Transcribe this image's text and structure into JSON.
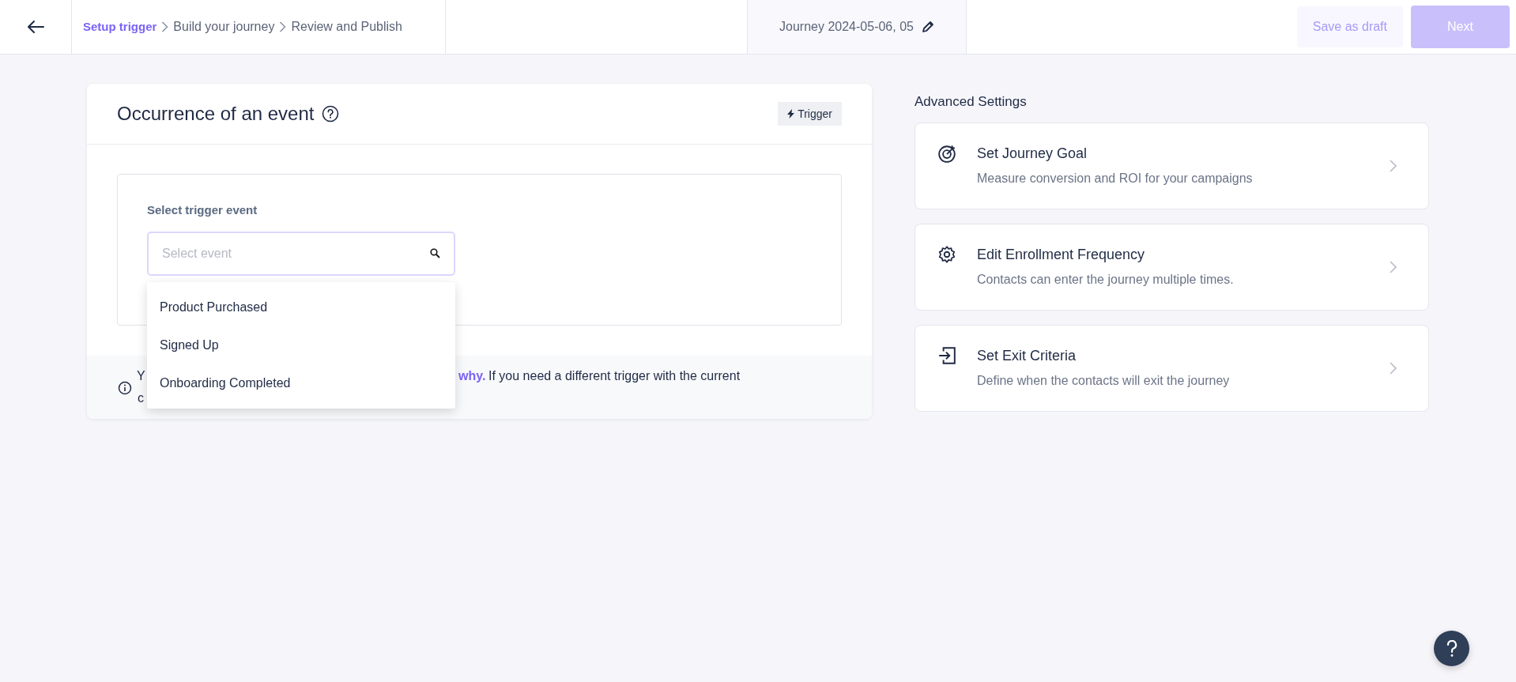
{
  "breadcrumb": [
    {
      "label": "Setup trigger",
      "selected": true
    },
    {
      "label": "Build your journey",
      "selected": false
    },
    {
      "label": "Review and Publish",
      "selected": false
    }
  ],
  "journey_title": "Journey 2024-05-06, 05",
  "actions": {
    "save_draft": "Save as draft",
    "next": {
      "label": "Next",
      "disabled": true
    }
  },
  "trigger_card": {
    "title": "Occurrence of an event",
    "badge": "Trigger",
    "field_label": "Select trigger event",
    "search": {
      "placeholder": "Select event"
    },
    "options": [
      "Product Purchased",
      "Signed Up",
      "Onboarding Completed"
    ],
    "note": {
      "line1_start": "Y",
      "link": "why.",
      "line1_end": "If you need a different trigger with the current",
      "line2_start": "c"
    }
  },
  "advanced_settings": {
    "title": "Advanced Settings",
    "items": [
      {
        "kind": "goal",
        "title": "Set Journey Goal",
        "description": "Measure conversion and ROI for your campaigns"
      },
      {
        "kind": "frequency",
        "title": "Edit Enrollment Frequency",
        "description": "Contacts can enter the journey multiple times."
      },
      {
        "kind": "exit",
        "title": "Set Exit Criteria",
        "description": "Define when the contacts will exit the journey"
      }
    ]
  }
}
